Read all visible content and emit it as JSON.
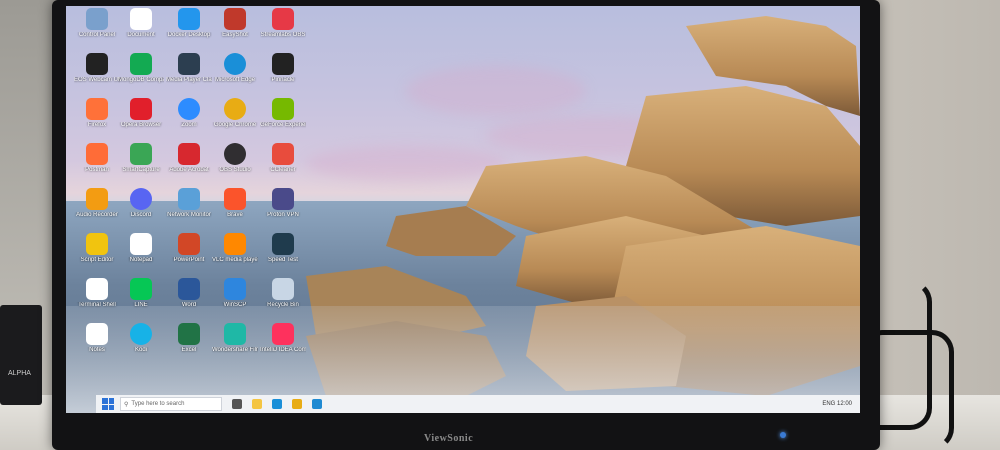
{
  "monitor": {
    "brand": "ViewSonic"
  },
  "device_label": "ALPHA",
  "desktop": {
    "icons": [
      {
        "label": "Control Panel",
        "color": "#7aa0cc",
        "glyph": "gear"
      },
      {
        "label": "Document",
        "color": "#ffffff",
        "glyph": "doc"
      },
      {
        "label": "Docker Desktop",
        "color": "#2396ed",
        "glyph": "whale"
      },
      {
        "label": "EasyShot",
        "color": "#c0392b",
        "glyph": "square"
      },
      {
        "label": "Streamlabs OBS",
        "color": "#e63946",
        "glyph": "square"
      },
      {
        "label": "EOS Webcam Utility",
        "color": "#222222",
        "glyph": "camera"
      },
      {
        "label": "MongoDB Compass",
        "color": "#13aa52",
        "glyph": "leaf"
      },
      {
        "label": "Media Player Classic",
        "color": "#2c3e50",
        "glyph": "film"
      },
      {
        "label": "Microsoft Edge",
        "color": "#1a8fd8",
        "glyph": "edge"
      },
      {
        "label": "Pinnacle",
        "color": "#222222",
        "glyph": "P"
      },
      {
        "label": "Firefox",
        "color": "#ff7139",
        "glyph": "fox"
      },
      {
        "label": "Opera Browser",
        "color": "#e11f2b",
        "glyph": "O"
      },
      {
        "label": "Zoom",
        "color": "#2d8cff",
        "glyph": "zoom"
      },
      {
        "label": "Google Chrome",
        "color": "#e8ac14",
        "glyph": "chrome"
      },
      {
        "label": "GeForce Experience",
        "color": "#76b900",
        "glyph": "nv"
      },
      {
        "label": "Postman",
        "color": "#ff6c37",
        "glyph": "pm"
      },
      {
        "label": "SmartCapture",
        "color": "#3aa655",
        "glyph": "sc"
      },
      {
        "label": "Adobe Acrobat",
        "color": "#d7282f",
        "glyph": "pdf"
      },
      {
        "label": "OBS Studio",
        "color": "#302e31",
        "glyph": "obs"
      },
      {
        "label": "CCleaner",
        "color": "#e84c3d",
        "glyph": "cc"
      },
      {
        "label": "Audio Recorder",
        "color": "#f39c12",
        "glyph": "rec"
      },
      {
        "label": "Discord",
        "color": "#5865f2",
        "glyph": "dc"
      },
      {
        "label": "Network Monitor",
        "color": "#5aa0d8",
        "glyph": "net"
      },
      {
        "label": "Brave",
        "color": "#fb542b",
        "glyph": "brave"
      },
      {
        "label": "Proton VPN",
        "color": "#4a4a8a",
        "glyph": "vpn"
      },
      {
        "label": "Script Editor",
        "color": "#f1c40f",
        "glyph": "pen"
      },
      {
        "label": "Notepad",
        "color": "#ffffff",
        "glyph": "doc"
      },
      {
        "label": "PowerPoint",
        "color": "#d24726",
        "glyph": "P"
      },
      {
        "label": "VLC media player",
        "color": "#ff8800",
        "glyph": "cone"
      },
      {
        "label": "Speed Test",
        "color": "#1f3b4d",
        "glyph": "speed"
      },
      {
        "label": "Terminal Shell",
        "color": "#ffffff",
        "glyph": "doc"
      },
      {
        "label": "LINE",
        "color": "#06c755",
        "glyph": "line"
      },
      {
        "label": "Word",
        "color": "#2b579a",
        "glyph": "W"
      },
      {
        "label": "WinSCP",
        "color": "#2e86de",
        "glyph": "scp"
      },
      {
        "label": "Recycle Bin",
        "color": "#c8d6e5",
        "glyph": "bin"
      },
      {
        "label": "Notes",
        "color": "#ffffff",
        "glyph": "doc"
      },
      {
        "label": "Kodi",
        "color": "#17b2e7",
        "glyph": "kodi"
      },
      {
        "label": "Excel",
        "color": "#217346",
        "glyph": "X"
      },
      {
        "label": "Wondershare Filmora X",
        "color": "#1fb8a6",
        "glyph": "film"
      },
      {
        "label": "IntelliJ IDEA Community",
        "color": "#fe315d",
        "glyph": "ij"
      }
    ]
  },
  "taskbar": {
    "search_placeholder": "Type here to search",
    "apps": [
      {
        "name": "task-view",
        "color": "#555"
      },
      {
        "name": "file-explorer",
        "color": "#f4c542"
      },
      {
        "name": "edge",
        "color": "#1a8fd8"
      },
      {
        "name": "chrome",
        "color": "#e8ac14"
      },
      {
        "name": "vscode",
        "color": "#1f8ad2"
      }
    ],
    "tray": "ENG  12:00"
  }
}
